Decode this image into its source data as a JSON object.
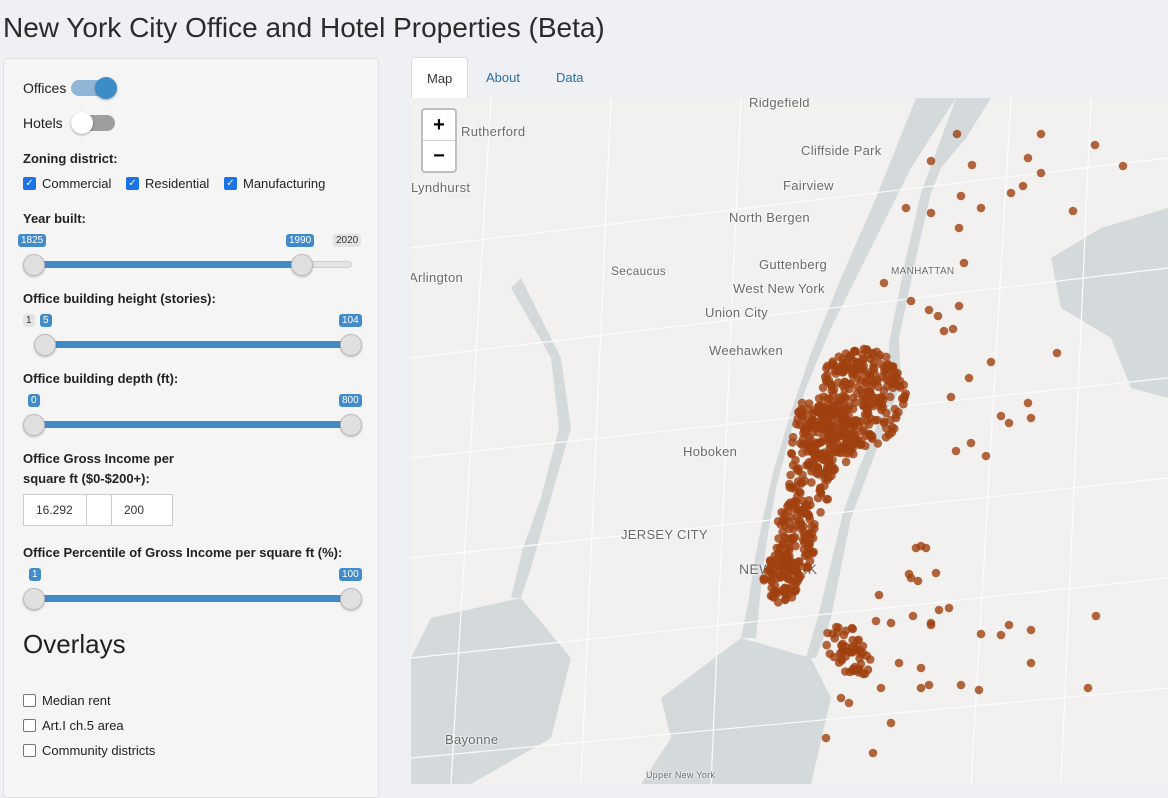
{
  "app": {
    "title": "New York City Office and Hotel Properties (Beta)"
  },
  "toggles": [
    {
      "label": "Offices",
      "on": true
    },
    {
      "label": "Hotels",
      "on": false
    }
  ],
  "zoning": {
    "label": "Zoning district:",
    "options": [
      {
        "label": "Commercial",
        "checked": true
      },
      {
        "label": "Residential",
        "checked": true
      },
      {
        "label": "Manufacturing",
        "checked": true
      }
    ]
  },
  "year_built": {
    "label": "Year built:",
    "min": 1825,
    "max": 2020,
    "from": 1825,
    "to": 1990,
    "min_label": "1825",
    "max_label": "2020",
    "from_label": "1825",
    "to_label": "1990"
  },
  "height": {
    "label": "Office building height (stories):",
    "min": 1,
    "max": 104,
    "from": 5,
    "to": 104,
    "min_label": "1",
    "from_label": "5",
    "to_label": "104"
  },
  "depth": {
    "label": "Office building depth (ft):",
    "min": 0,
    "max": 800,
    "from": 0,
    "to": 800,
    "from_label": "0",
    "to_label": "800"
  },
  "gross_income": {
    "label_line1": "Office Gross Income per",
    "label_line2": "square ft ($0-$200+):",
    "min_value": "16.292",
    "max_value": "200"
  },
  "percentile": {
    "label": "Office Percentile of Gross Income per square ft (%):",
    "min": 1,
    "max": 100,
    "from": 1,
    "to": 100,
    "from_label": "1",
    "to_label": "100"
  },
  "overlays": {
    "title": "Overlays",
    "options": [
      {
        "label": "Median rent",
        "checked": false
      },
      {
        "label": "Art.I ch.5 area",
        "checked": false
      },
      {
        "label": "Community districts",
        "checked": false
      }
    ]
  },
  "tabs": [
    {
      "label": "Map",
      "active": true
    },
    {
      "label": "About",
      "active": false
    },
    {
      "label": "Data",
      "active": false
    }
  ],
  "map": {
    "zoom_in": "+",
    "zoom_out": "−",
    "place_labels": [
      "Ridgefield",
      "Rutherford",
      "Cliffside Park",
      "Lyndhurst",
      "Fairview",
      "North Bergen",
      "Secaucus",
      "Guttenberg",
      "MANHATTAN",
      "Arlington",
      "West New York",
      "Union City",
      "Weehawken",
      "Hoboken",
      "JERSEY CITY",
      "NEW YORK",
      "Bayonne",
      "Upper New York"
    ],
    "marker_color": "#a0400f",
    "water_color": "#d4dadc",
    "land_color": "#f2f1ef"
  },
  "colors": {
    "accent": "#428bca",
    "switch_on": "#3c8dc5",
    "tab_link": "#2a6ea6"
  }
}
